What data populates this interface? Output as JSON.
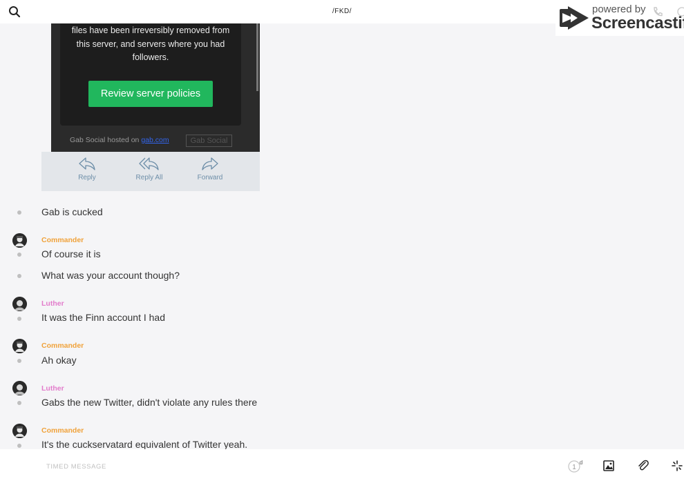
{
  "header": {
    "title": "/FKD/"
  },
  "watermark": {
    "powered": "powered by",
    "brand": "Screencastify"
  },
  "email": {
    "body_lines": [
      "files have been irreversibly removed from",
      "this server, and servers where you had",
      "followers."
    ],
    "button_label": "Review server policies",
    "footer_prefix": "Gab Social hosted on ",
    "footer_link": "gab.com",
    "logo_text": "Gab Social",
    "actions": [
      "Reply",
      "Reply All",
      "Forward"
    ]
  },
  "colors": {
    "commander": "#f0a23a",
    "luther": "#e27ccb",
    "button_green": "#21b75d"
  },
  "messages": [
    {
      "text": "Gab is cucked"
    },
    {
      "author": "Commander",
      "text": "Of course it is"
    },
    {
      "text": "What was your account though?"
    },
    {
      "author": "Luther",
      "text": "It was the Finn account I had"
    },
    {
      "author": "Commander",
      "text": "Ah okay"
    },
    {
      "author": "Luther",
      "text": "Gabs the new Twitter, didn't violate any rules there"
    },
    {
      "author": "Commander",
      "text": "It's the cuckservatard equivalent of Twitter yeah."
    }
  ],
  "composer": {
    "placeholder": "TIMED MESSAGE",
    "timer_value": "1",
    "timer_unit": "d"
  }
}
